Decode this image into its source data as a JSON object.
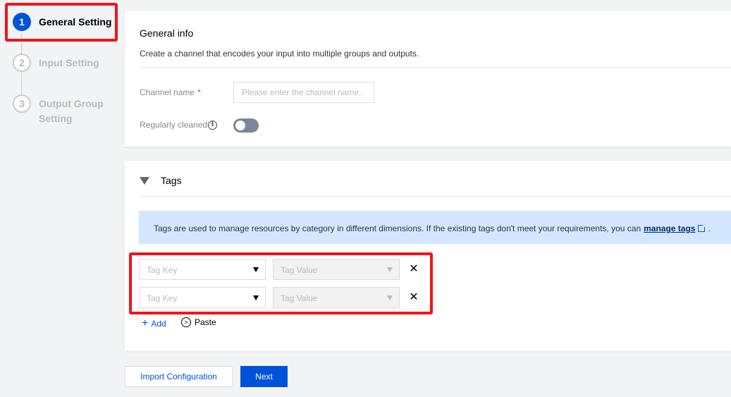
{
  "steps": [
    {
      "number": "1",
      "label": "General Setting"
    },
    {
      "number": "2",
      "label": "Input Setting"
    },
    {
      "number": "3",
      "label": "Output Group",
      "label2": "Setting"
    }
  ],
  "general": {
    "title": "General info",
    "description": "Create a channel that encodes your input into multiple groups and outputs.",
    "channel_name_label": "Channel name",
    "required_mark": "*",
    "channel_name_placeholder": "Please enter the channel name.",
    "regularly_cleaned_label": "Regularly cleaned",
    "regularly_cleaned_on": false
  },
  "tags": {
    "title": "Tags",
    "notice_text": "Tags are used to manage resources by category in different dimensions. If the existing tags don't meet your requirements, you can",
    "notice_link": "manage tags",
    "notice_end": ".",
    "rows": [
      {
        "key_placeholder": "Tag Key",
        "value_placeholder": "Tag Value"
      },
      {
        "key_placeholder": "Tag Key",
        "value_placeholder": "Tag Value"
      }
    ],
    "add_label": "Add",
    "paste_label": "Paste"
  },
  "footer": {
    "import_label": "Import Configuration",
    "next_label": "Next"
  },
  "colors": {
    "primary": "#0052d9",
    "highlight": "#f2141a",
    "notice_bg": "#d5e7ff"
  }
}
